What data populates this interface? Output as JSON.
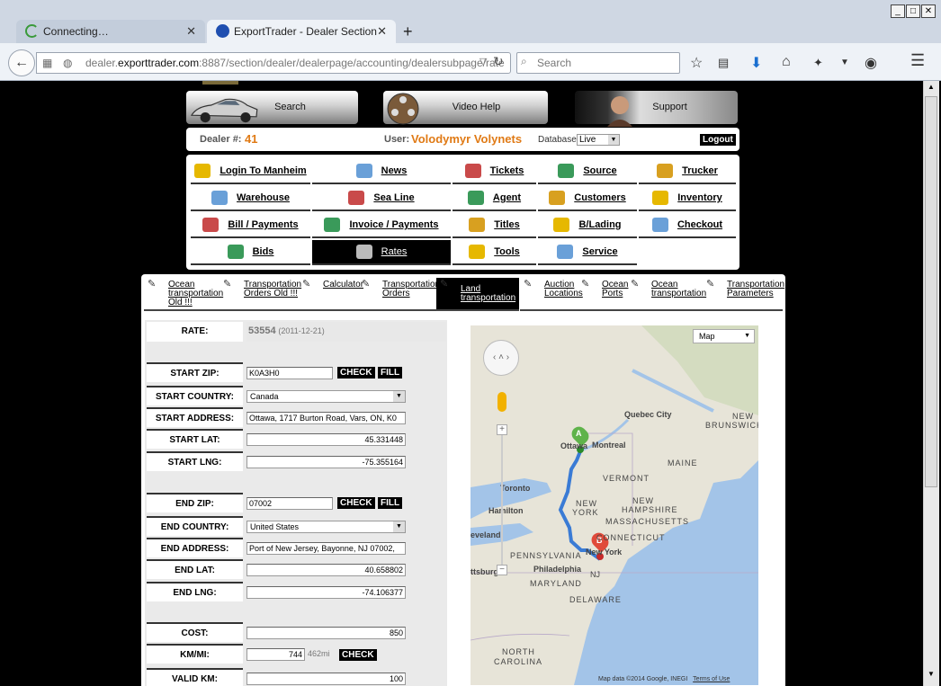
{
  "browser": {
    "tabs": [
      {
        "title": "Connecting…",
        "active": false
      },
      {
        "title": "ExportTrader - Dealer Section",
        "active": true
      }
    ],
    "url_prefix": "dealer.",
    "url_domain": "exporttrader.com",
    "url_rest": ":8887/section/dealer/dealerpage/accounting/dealersubpage/rate",
    "search_placeholder": "Search",
    "window_buttons": [
      "_",
      "□",
      "✕"
    ]
  },
  "top_buttons": [
    {
      "label": "Search"
    },
    {
      "label": "Video Help"
    },
    {
      "label": "Support"
    }
  ],
  "userbar": {
    "dealer_label": "Dealer #:",
    "dealer_no": "41",
    "user_label": "User:",
    "user_name": "Volodymyr Volynets",
    "database_label": "Database:",
    "database_value": "Live",
    "logout": "Logout"
  },
  "menu": [
    [
      "Login To Manheim",
      "News",
      "Tickets",
      "Source",
      "Trucker"
    ],
    [
      "Warehouse",
      "Sea Line",
      "Agent",
      "Customers",
      "Inventory"
    ],
    [
      "Bill / Payments",
      "Invoice / Payments",
      "Titles",
      "B/Lading",
      "Checkout"
    ],
    [
      "Bids",
      "Rates",
      "Tools",
      "Service"
    ]
  ],
  "menu_active": "Rates",
  "subtabs": [
    "Ocean transportation Old !!!",
    "Transportation Orders Old !!!",
    "Calculator",
    "Transportation Orders",
    "Land transportation",
    "Auction Locations",
    "Ocean Ports",
    "Ocean transportation",
    "Transportation Parameters"
  ],
  "subtab_active": "Land transportation",
  "form": {
    "rate_label": "RATE:",
    "rate_value": "53554",
    "rate_date": "(2011-12-21)",
    "start_zip_label": "START ZIP:",
    "start_zip": "K0A3H0",
    "start_country_label": "START COUNTRY:",
    "start_country": "Canada",
    "start_address_label": "START ADDRESS:",
    "start_address": "Ottawa, 1717 Burton Road, Vars, ON, K0",
    "start_lat_label": "START LAT:",
    "start_lat": "45.331448",
    "start_lng_label": "START LNG:",
    "start_lng": "-75.355164",
    "end_zip_label": "END ZIP:",
    "end_zip": "07002",
    "end_country_label": "END COUNTRY:",
    "end_country": "United States",
    "end_address_label": "END ADDRESS:",
    "end_address": "Port of New Jersey, Bayonne, NJ 07002,",
    "end_lat_label": "END LAT:",
    "end_lat": "40.658802",
    "end_lng_label": "END LNG:",
    "end_lng": "-74.106377",
    "cost_label": "COST:",
    "cost": "850",
    "kmmi_label": "KM/MI:",
    "km": "744",
    "mi": "462mi",
    "valid_km_label": "VALID KM:",
    "valid_km": "100",
    "check": "CHECK",
    "fill": "FILL"
  },
  "map": {
    "type_select": "Map",
    "footer_data": "Map data ©2014 Google, INEGI",
    "footer_terms": "Terms of Use",
    "marker_a": "A",
    "marker_b": "B",
    "labels": {
      "quebec_city": "Quebec City",
      "ottawa": "Ottawa",
      "montreal": "Montreal",
      "new_brunswick_1": "NEW",
      "new_brunswick_2": "BRUNSWICK",
      "maine": "MAINE",
      "vermont": "VERMONT",
      "toronto": "Toronto",
      "new_hampshire_1": "NEW",
      "new_hampshire_2": "HAMPSHIRE",
      "hamilton": "Hamilton",
      "new_york_1": "NEW",
      "new_york_2": "YORK",
      "massachusetts": "MASSACHUSETTS",
      "cleveland": "eveland",
      "connecticut": "CONNECTICUT",
      "pennsylvania": "PENNSYLVANIA",
      "new_york_city": "New York",
      "pittsburgh": "ttsburgh",
      "philadelphia": "Philadelphia",
      "nj": "NJ",
      "maryland": "MARYLAND",
      "delaware": "DELAWARE",
      "north_carolina_1": "NORTH",
      "north_carolina_2": "CAROLINA"
    }
  }
}
